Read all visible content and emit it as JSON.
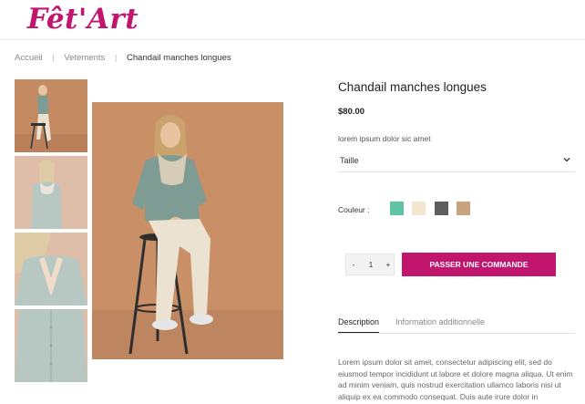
{
  "header": {
    "logo_text": "Fêt'Art"
  },
  "breadcrumb": {
    "items": [
      "Accueil",
      "Vetements"
    ],
    "current": "Chandail manches longues",
    "separator": "|"
  },
  "product": {
    "title": "Chandail manches longues",
    "price": "$80.00",
    "subtitle": "lorem ipsum dolor sic amet",
    "size_select": {
      "value": "Taille",
      "icon": "chevron-down-icon"
    },
    "color_label": "Couleur :",
    "colors": [
      "#5ec4a3",
      "#f5e6cf",
      "#5e5e5e",
      "#c9a27f"
    ]
  },
  "order": {
    "quantity": "1",
    "minus": "-",
    "plus": "+",
    "button_label": "PASSER UNE COMMANDE"
  },
  "tabs": {
    "description": "Description",
    "additional": "Information additionnelle"
  },
  "description_text": "Lorem ipsum dolor sit amet, consectetur adipiscing elit, sed do eiusmod tempor incididunt ut labore et dolore magna aliqua. Ut enim ad minim veniam, quis nostrud exercitation ullamco laboris nisi ut aliquip ex ea commodo consequat. Duis aute irure dolor in",
  "colors": {
    "brand": "#c2166e",
    "background_photo": "#c98f66"
  }
}
